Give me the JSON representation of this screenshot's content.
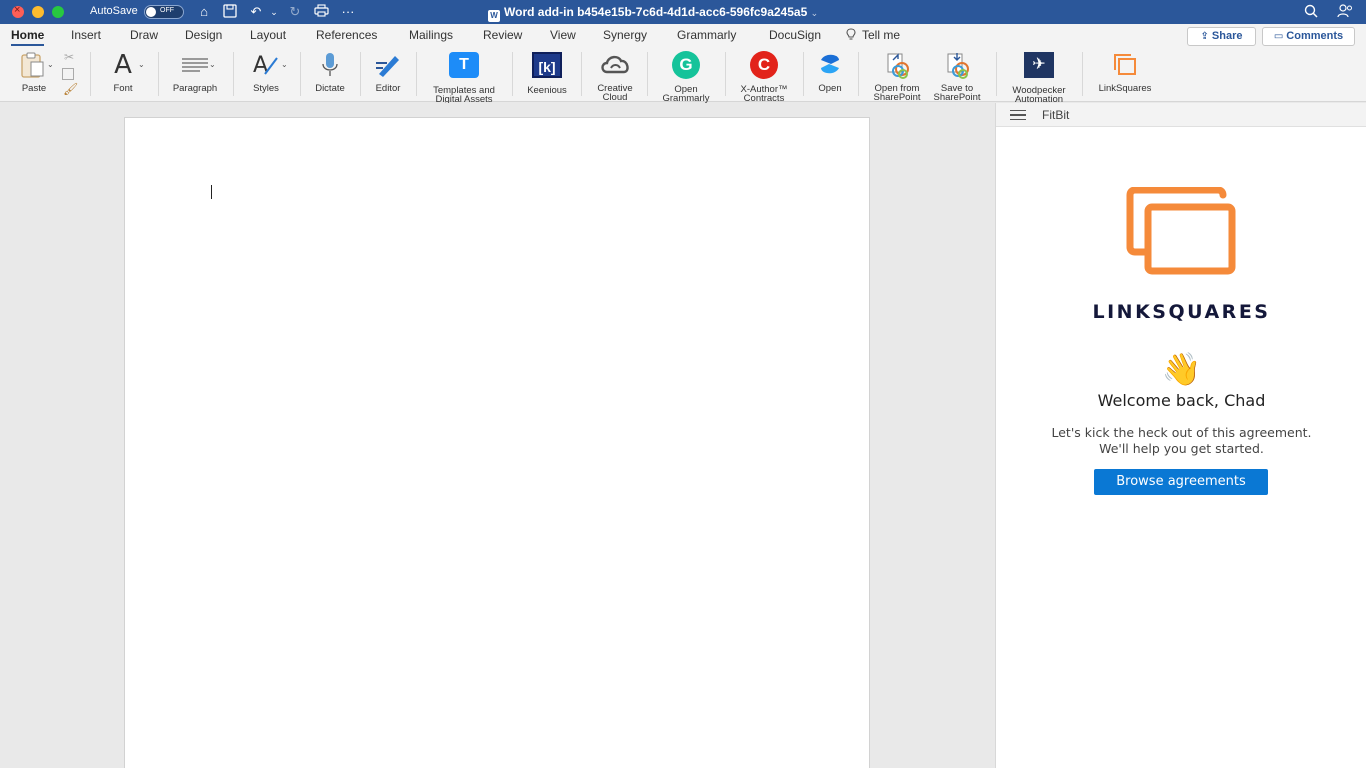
{
  "titlebar": {
    "autosave_label": "AutoSave",
    "autosave_state": "OFF",
    "document_title": "Word add-in b454e15b-7c6d-4d1d-acc6-596fc9a245a5"
  },
  "menu": {
    "tabs": [
      {
        "label": "Home",
        "active": true
      },
      {
        "label": "Insert"
      },
      {
        "label": "Draw"
      },
      {
        "label": "Design"
      },
      {
        "label": "Layout"
      },
      {
        "label": "References"
      },
      {
        "label": "Mailings"
      },
      {
        "label": "Review"
      },
      {
        "label": "View"
      },
      {
        "label": "Synergy"
      },
      {
        "label": "Grammarly"
      },
      {
        "label": "DocuSign"
      }
    ],
    "tell_me": "Tell me",
    "share": "Share",
    "comments": "Comments"
  },
  "ribbon": {
    "paste": "Paste",
    "font": "Font",
    "paragraph": "Paragraph",
    "styles": "Styles",
    "dictate": "Dictate",
    "editor": "Editor",
    "templates_l1": "Templates and",
    "templates_l2": "Digital Assets",
    "keenious": "Keenious",
    "creative_l1": "Creative",
    "creative_l2": "Cloud",
    "grammarly_l1": "Open",
    "grammarly_l2": "Grammarly",
    "xauthor_l1": "X-Author™",
    "xauthor_l2": "Contracts",
    "open": "Open",
    "open_sp_l1": "Open from",
    "open_sp_l2": "SharePoint",
    "save_sp_l1": "Save to",
    "save_sp_l2": "SharePoint",
    "woodpecker_l1": "Woodpecker",
    "woodpecker_l2": "Automation",
    "linksquares": "LinkSquares"
  },
  "pane": {
    "title": "FitBit",
    "brand": "LINKSQUARES",
    "wave": "👋",
    "welcome": "Welcome back, Chad",
    "subtitle_1": "Let's kick the heck out of this agreement.",
    "subtitle_2": "We'll help you get started.",
    "browse_button": "Browse agreements"
  },
  "colors": {
    "titlebar_blue": "#2b579a",
    "brand_orange": "#f58a3a",
    "brand_navy": "#14183a",
    "button_blue": "#0a78d4"
  }
}
